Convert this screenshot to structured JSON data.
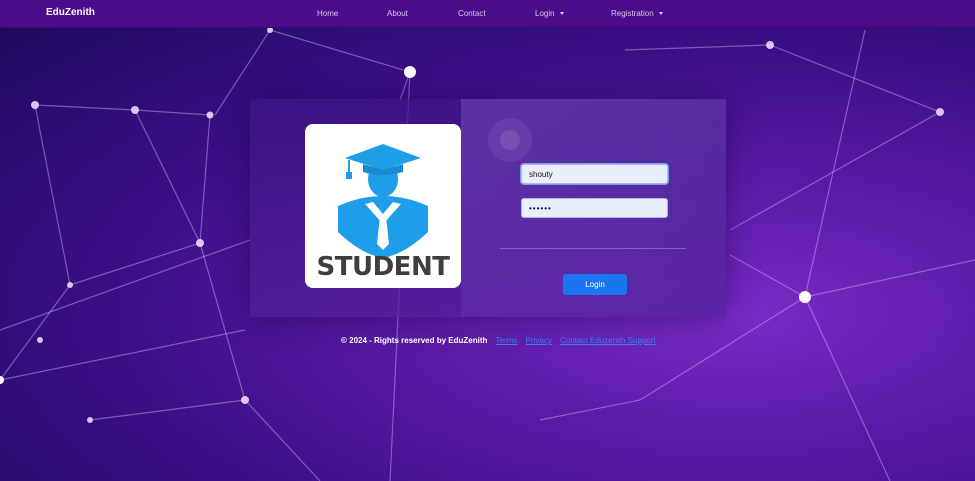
{
  "navbar": {
    "brand": "EduZenith",
    "links": [
      {
        "label": "Home"
      },
      {
        "label": "About"
      },
      {
        "label": "Contact"
      },
      {
        "label": "Login"
      },
      {
        "label": "Registration"
      }
    ]
  },
  "logo": {
    "text": "STUDENT",
    "icon": "student-graduate-icon"
  },
  "form": {
    "username_value": "shouty",
    "password_value": "••••••",
    "login_label": "Login"
  },
  "footer": {
    "copyright": "© 2024 - Rights reserved by EduZenith",
    "links": [
      {
        "label": "Terms"
      },
      {
        "label": "Privacy"
      },
      {
        "label": "Contact Eduzenith Support"
      }
    ]
  },
  "colors": {
    "navbar": "#4b0c8c",
    "accent_button": "#1976f0",
    "link": "#3b7fe6",
    "logo_blue": "#1e9ee8"
  }
}
